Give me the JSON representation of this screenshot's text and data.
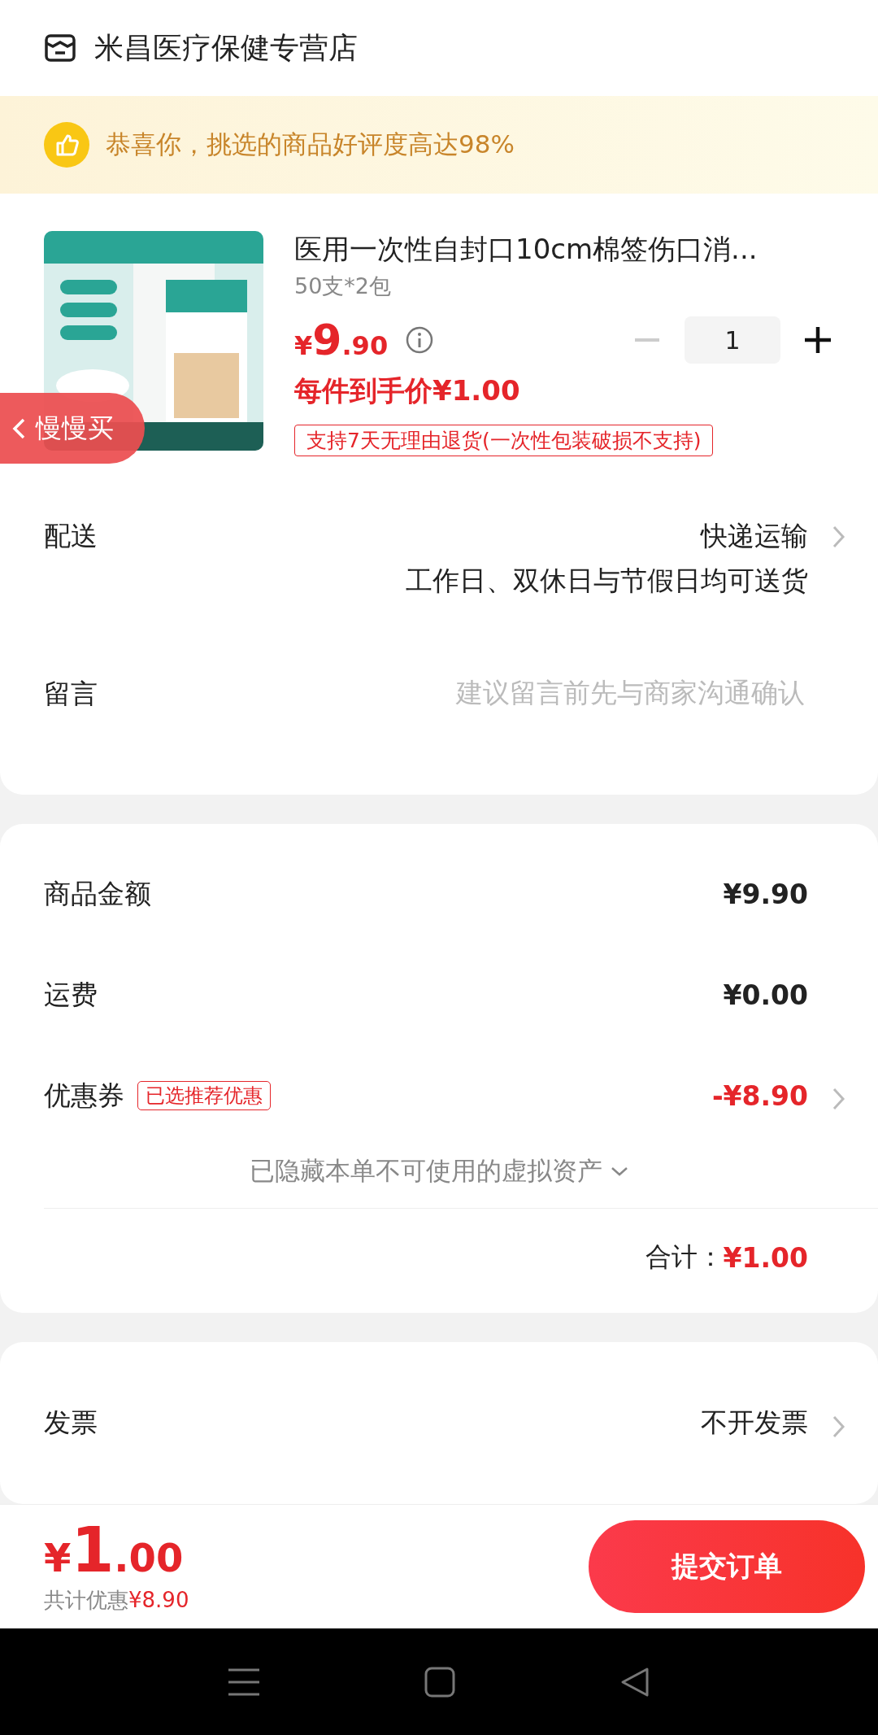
{
  "store": {
    "name": "米昌医疗保健专营店"
  },
  "banner": {
    "text": "恭喜你，挑选的商品好评度高达98%"
  },
  "product": {
    "title": "医用一次性自封口10cm棉签伤口消...",
    "spec": "50支*2包",
    "price_symbol": "¥",
    "price_int": "9",
    "price_dec": ".90",
    "quantity": "1",
    "minus_disabled": true,
    "unit_price": "每件到手价¥1.00",
    "return_policy": "支持7天无理由退货(一次性包装破损不支持)"
  },
  "floating_tab": {
    "label": "慢慢买"
  },
  "delivery": {
    "label": "配送",
    "value": "快递运输",
    "note": "工作日、双休日与节假日均可送货"
  },
  "message": {
    "label": "留言",
    "placeholder": "建议留言前先与商家沟通确认"
  },
  "summary": {
    "rows": [
      {
        "label": "商品金额",
        "value": "¥9.90",
        "kind": "plain"
      },
      {
        "label": "运费",
        "value": "¥0.00",
        "kind": "plain"
      },
      {
        "label": "优惠券",
        "tag": "已选推荐优惠",
        "value": "-¥8.90",
        "kind": "discount"
      }
    ],
    "hidden_note": "已隐藏本单不可使用的虚拟资产",
    "total_label": "合计：",
    "total_value": "¥1.00"
  },
  "invoice": {
    "label": "发票",
    "value": "不开发票"
  },
  "bottom_bar": {
    "symbol": "¥",
    "amount_int": "1",
    "amount_dec": ".00",
    "saving_label": "共计优惠",
    "saving_value": "¥8.90",
    "submit": "提交订单"
  }
}
